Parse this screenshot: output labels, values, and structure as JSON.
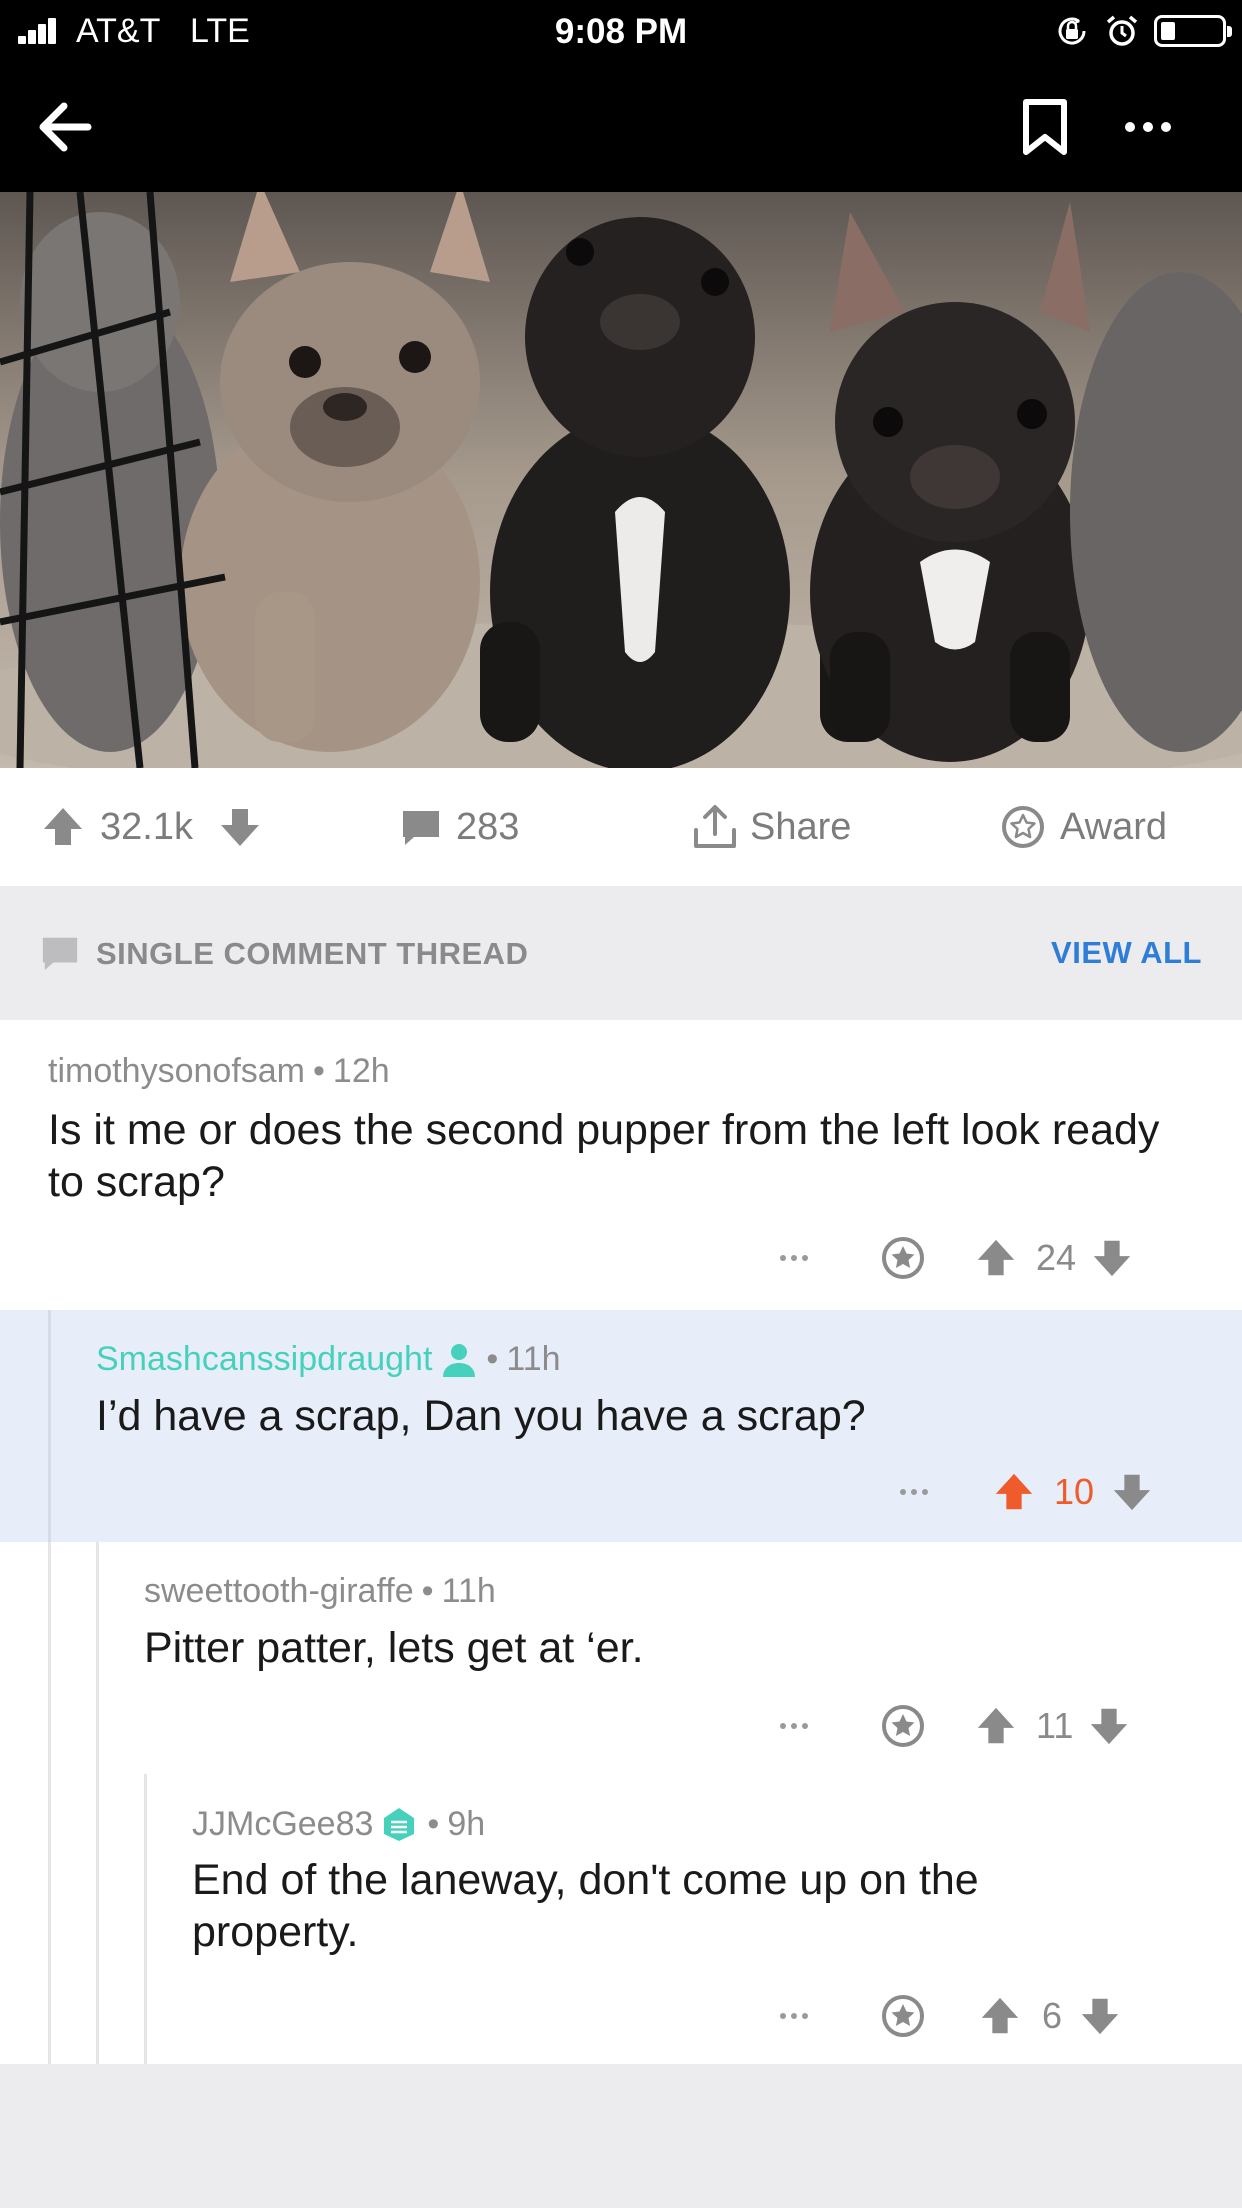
{
  "status_bar": {
    "carrier": "AT&T",
    "network": "LTE",
    "time": "9:08 PM",
    "icons": [
      "signal-icon",
      "rotation-lock-icon",
      "alarm-icon",
      "battery-icon"
    ]
  },
  "nav": {
    "icons": [
      "back-arrow-icon",
      "bookmark-icon",
      "more-icon"
    ]
  },
  "post": {
    "image_alt": "French bulldog puppies",
    "score": "32.1k",
    "comments_count": "283",
    "share_label": "Share",
    "award_label": "Award"
  },
  "thread": {
    "title": "SINGLE COMMENT THREAD",
    "view_all": "VIEW ALL"
  },
  "comments": [
    {
      "author": "timothysonofsam",
      "age": "12h",
      "body": "Is it me or does the second pupper from the left look ready to scrap?",
      "score": "24",
      "upvoted": false
    },
    {
      "author": "Smashcanssipdraught",
      "age": "11h",
      "body": "I’d have a scrap, Dan you have a scrap?",
      "score": "10",
      "upvoted": true,
      "is_op": true
    },
    {
      "author": "sweettooth-giraffe",
      "age": "11h",
      "body": "Pitter patter, lets get at ‘er.",
      "score": "11",
      "upvoted": false
    },
    {
      "author": "JJMcGee83",
      "age": "9h",
      "body": "End of the laneway, don't come up on the property.",
      "score": "6",
      "upvoted": false,
      "is_mod": true
    }
  ],
  "colors": {
    "upvote_orange": "#ef5b2a",
    "op_teal": "#46d1bd",
    "link_blue": "#2e7ed8",
    "highlight_bg": "#e8eef9"
  }
}
